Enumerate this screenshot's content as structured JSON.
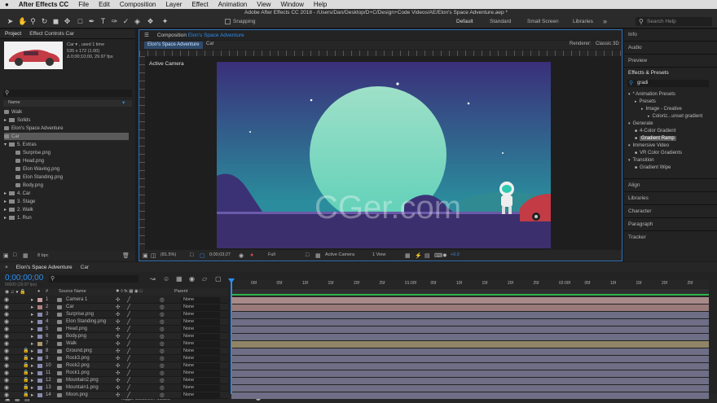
{
  "menu": {
    "app": "After Effects CC",
    "items": [
      "File",
      "Edit",
      "Composition",
      "Layer",
      "Effect",
      "Animation",
      "View",
      "Window",
      "Help"
    ]
  },
  "window_title": "Adobe After Effects CC 2018 - /Users/Dan/Desktop/D+C/Design+Code Videos/AE/Elon's Space Adventure.aep *",
  "toolbar": {
    "snapping": "Snapping",
    "workspaces": [
      "Default",
      "Standard",
      "Small Screen",
      "Libraries"
    ],
    "search_placeholder": "Search Help"
  },
  "project": {
    "tab": "Project",
    "effect_controls_tab": "Effect Controls Car",
    "item_name": "Car ▾ , used 1 time",
    "item_size": "535 x 172 (1.00)",
    "item_duration": "Δ 0;00;10;00, 29.97 fps",
    "column": "Name",
    "bpc": "8 bpc",
    "items": [
      {
        "name": "Walk",
        "type": "comp",
        "indent": 0
      },
      {
        "name": "Solids",
        "type": "folder",
        "indent": 0
      },
      {
        "name": "Elon's Space Adventure",
        "type": "comp",
        "indent": 0
      },
      {
        "name": "Car",
        "type": "comp",
        "indent": 0,
        "selected": true
      },
      {
        "name": "5. Extras",
        "type": "folder",
        "indent": 0,
        "open": true
      },
      {
        "name": "Surprise.png",
        "type": "file",
        "indent": 1
      },
      {
        "name": "Head.png",
        "type": "file",
        "indent": 1
      },
      {
        "name": "Elon Waving.png",
        "type": "file",
        "indent": 1
      },
      {
        "name": "Elon Standing.png",
        "type": "file",
        "indent": 1
      },
      {
        "name": "Body.png",
        "type": "file",
        "indent": 1
      },
      {
        "name": "4. Car",
        "type": "folder",
        "indent": 0
      },
      {
        "name": "3. Stage",
        "type": "folder",
        "indent": 0
      },
      {
        "name": "2. Walk",
        "type": "folder",
        "indent": 0
      },
      {
        "name": "1. Run",
        "type": "folder",
        "indent": 0
      }
    ]
  },
  "composition": {
    "panel_title": "Composition",
    "comp_name": "Elon's Space Adventure",
    "tabs": [
      "Elon's Space Adventure",
      "Car"
    ],
    "renderer_label": "Renderer:",
    "renderer": "Classic 3D",
    "active_camera": "Active Camera",
    "footer": {
      "zoom": "(81.5%)",
      "timecode": "0;00;03;27",
      "resolution": "Full",
      "view": "Active Camera",
      "views": "1 View",
      "exposure": "+0.0"
    }
  },
  "right_panel": {
    "sections": [
      "Info",
      "Audio",
      "Preview"
    ],
    "effects_title": "Effects & Presets",
    "search": "gradi",
    "tree": [
      {
        "label": "* Animation Presets",
        "indent": 0
      },
      {
        "label": "Presets",
        "indent": 1
      },
      {
        "label": "Image - Creative",
        "indent": 2
      },
      {
        "label": "Coloriz...unset gradient",
        "indent": 3
      },
      {
        "label": "Generate",
        "indent": 0
      },
      {
        "label": "4-Color Gradient",
        "indent": 1
      },
      {
        "label": "Gradient Ramp",
        "indent": 1,
        "selected": true
      },
      {
        "label": "Immersive Video",
        "indent": 0
      },
      {
        "label": "VR Color Gradients",
        "indent": 1
      },
      {
        "label": "Transition",
        "indent": 0
      },
      {
        "label": "Gradient Wipe",
        "indent": 1
      }
    ],
    "lower": [
      "Align",
      "Libraries",
      "Character",
      "Paragraph",
      "Tracker"
    ]
  },
  "timeline": {
    "tabs": [
      "Elon's Space Adventure",
      "Car"
    ],
    "timecode": "0;00;00;00",
    "frame_info": "00000 (29.97 fps)",
    "col_source": "Source Name",
    "col_parent": "Parent",
    "toggle": "Toggle Switches / Modes",
    "ruler": [
      "00f",
      "05f",
      "10f",
      "15f",
      "20f",
      "25f",
      "01:00f",
      "05f",
      "10f",
      "15f",
      "20f",
      "25f",
      "02:00f",
      "05f",
      "10f",
      "15f",
      "20f",
      "25f"
    ],
    "layers": [
      {
        "num": "1",
        "name": "Camera 1",
        "color": "#c8a0a0",
        "parent": "None"
      },
      {
        "num": "2",
        "name": "Car",
        "color": "#b08080",
        "parent": "None"
      },
      {
        "num": "3",
        "name": "Surprise.png",
        "color": "#8a8ab0",
        "parent": "None"
      },
      {
        "num": "4",
        "name": "Elon Standing.png",
        "color": "#8a8ab0",
        "parent": "None"
      },
      {
        "num": "5",
        "name": "Head.png",
        "color": "#8a8ab0",
        "parent": "None"
      },
      {
        "num": "6",
        "name": "Body.png",
        "color": "#8a8ab0",
        "parent": "None"
      },
      {
        "num": "7",
        "name": "Walk",
        "color": "#a89a6a",
        "parent": "None"
      },
      {
        "num": "8",
        "name": "Ground.png",
        "color": "#8a8ab0",
        "parent": "None"
      },
      {
        "num": "9",
        "name": "Rock3.png",
        "color": "#8a8ab0",
        "parent": "None"
      },
      {
        "num": "10",
        "name": "Rock2.png",
        "color": "#8a8ab0",
        "parent": "None"
      },
      {
        "num": "11",
        "name": "Rock1.png",
        "color": "#8a8ab0",
        "parent": "None"
      },
      {
        "num": "12",
        "name": "Mountain2.png",
        "color": "#8a8ab0",
        "parent": "None"
      },
      {
        "num": "13",
        "name": "Mountain1.png",
        "color": "#8a8ab0",
        "parent": "None"
      },
      {
        "num": "14",
        "name": "Moon.png",
        "color": "#8a8ab0",
        "parent": "None"
      }
    ]
  },
  "watermark": "CGer.com",
  "colors": {
    "accent": "#2d8ceb",
    "moon_top": "#9fe0c8",
    "moon_bottom": "#5fd0b8",
    "sky_top": "#3a2f7a",
    "sky_bottom": "#2a8c9c",
    "ground": "#3c2f6e"
  }
}
